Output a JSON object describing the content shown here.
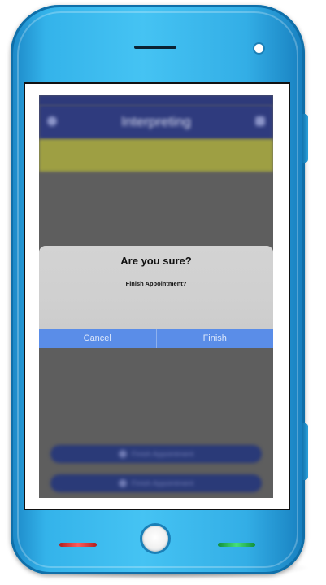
{
  "device": {
    "body_color": "#36b0e8",
    "accent_red": "#e34040",
    "accent_green": "#2fd067"
  },
  "app": {
    "status_bar": {
      "carrier": "",
      "time": "",
      "battery": ""
    },
    "nav_title": "Interpreting",
    "nav_left_icon": "menu-icon",
    "nav_right_icon": "settings-icon",
    "banner_text": "",
    "background_buttons": [
      {
        "label": "Finish Appointment",
        "icon": "check-icon"
      },
      {
        "label": "Finish Appointment",
        "icon": "check-icon"
      }
    ],
    "colors": {
      "nav": "#2f3b7e",
      "banner": "#9e9f43",
      "overlay": "#5e5e5e",
      "alert_button": "#5a8de8"
    }
  },
  "alert": {
    "title": "Are you sure?",
    "message": "Finish Appointment?",
    "cancel_label": "Cancel",
    "confirm_label": "Finish"
  }
}
